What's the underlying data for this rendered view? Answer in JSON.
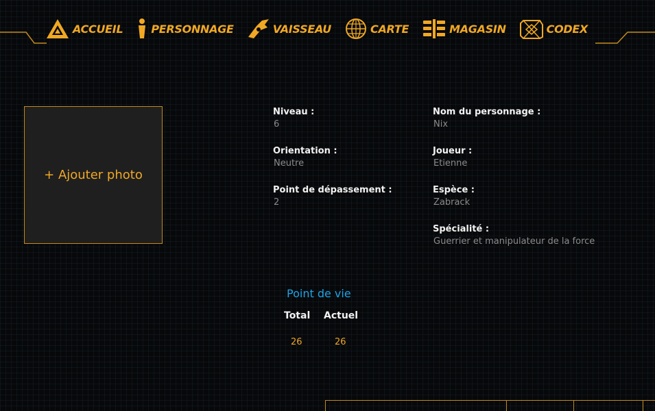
{
  "nav": {
    "items": [
      {
        "label": "ACCUEIL",
        "icon": "home-icon"
      },
      {
        "label": "PERSONNAGE",
        "icon": "person-icon"
      },
      {
        "label": "VAISSEAU",
        "icon": "ship-icon"
      },
      {
        "label": "CARTE",
        "icon": "globe-icon"
      },
      {
        "label": "MAGASIN",
        "icon": "shop-icon"
      },
      {
        "label": "CODEX",
        "icon": "codex-cube-icon"
      }
    ],
    "accent_color": "#f0a824"
  },
  "photo": {
    "label": "+ Ajouter photo"
  },
  "character": {
    "niveau": {
      "label": "Niveau :",
      "value": "6"
    },
    "orientation": {
      "label": "Orientation :",
      "value": "Neutre"
    },
    "depassement": {
      "label": "Point de dépassement :",
      "value": "2"
    },
    "nom": {
      "label": "Nom du personnage :",
      "value": "Nix"
    },
    "joueur": {
      "label": "Joueur :",
      "value": "Etienne"
    },
    "espece": {
      "label": "Espèce :",
      "value": "Zabrack"
    },
    "specialite": {
      "label": "Spécialité :",
      "value": "Guerrier et manipulateur de la force"
    }
  },
  "hp": {
    "title": "Point de vie",
    "total_label": "Total",
    "actuel_label": "Actuel",
    "total_value": "26",
    "actuel_value": "26",
    "title_color": "#1ea3e6"
  }
}
